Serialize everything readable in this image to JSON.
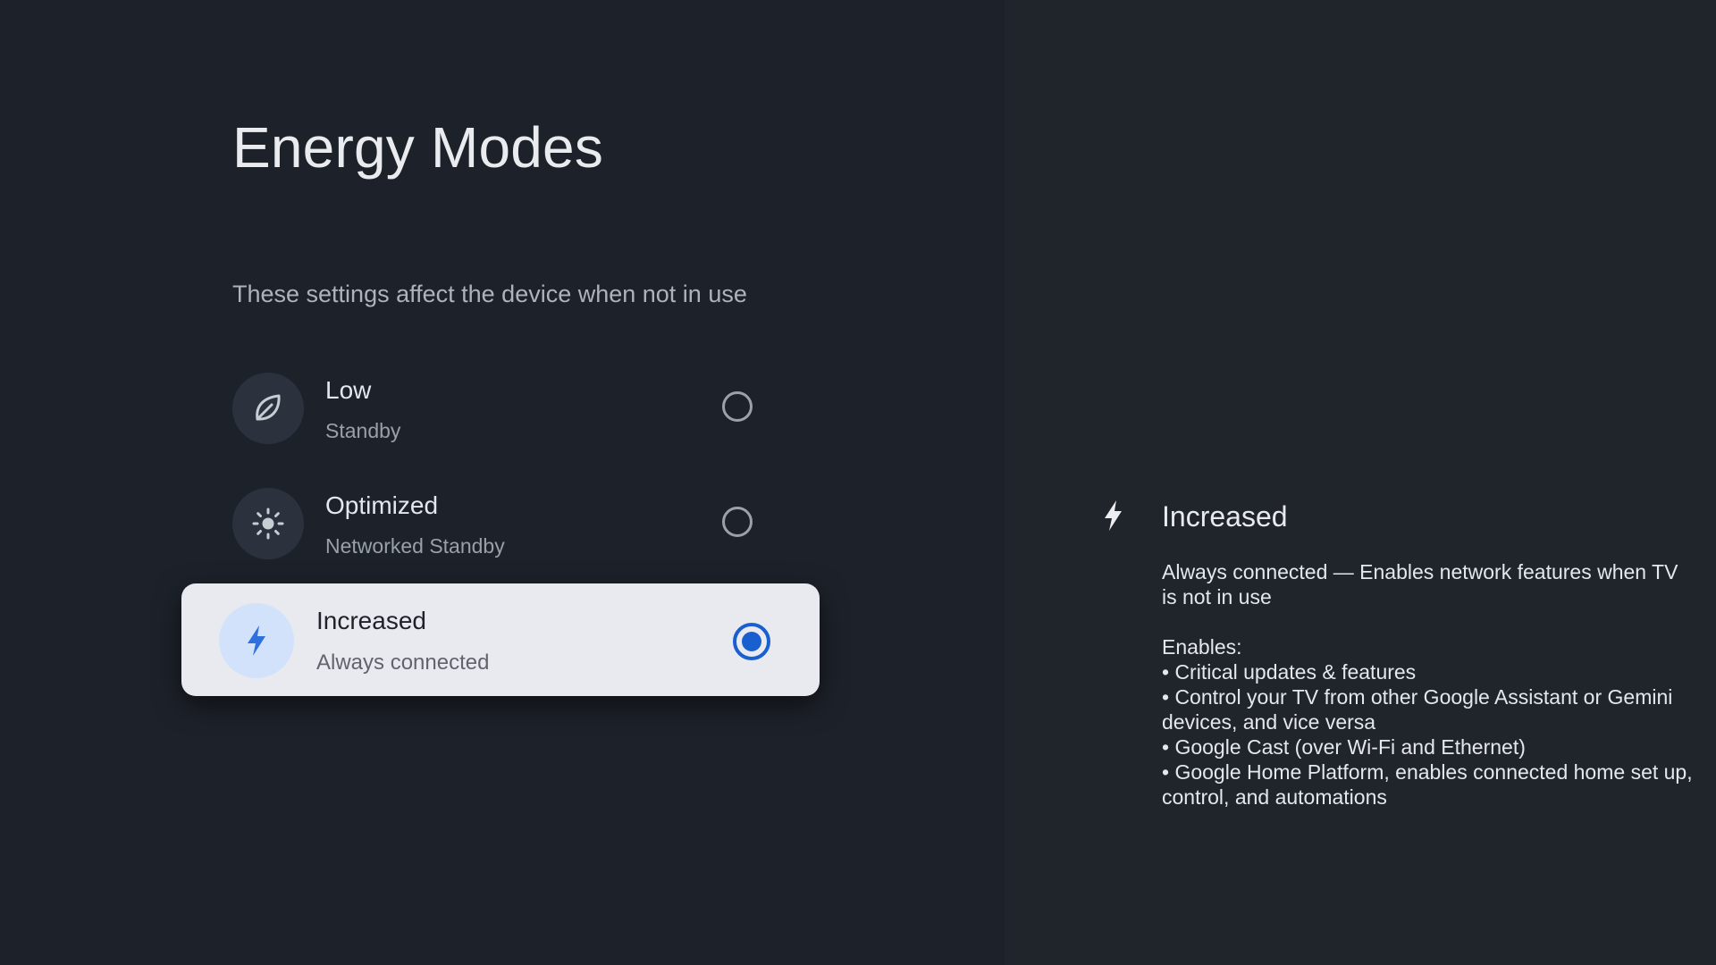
{
  "page": {
    "title": "Energy Modes",
    "subtitle": "These settings affect the device when not in use"
  },
  "options": [
    {
      "label": "Low",
      "sublabel": "Standby",
      "icon": "leaf-icon",
      "selected": false
    },
    {
      "label": "Optimized",
      "sublabel": "Networked Standby",
      "icon": "sun-icon",
      "selected": false
    },
    {
      "label": "Increased",
      "sublabel": "Always connected",
      "icon": "bolt-icon",
      "selected": true
    }
  ],
  "detail": {
    "icon": "bolt-icon",
    "title": "Increased",
    "description": "Always connected — Enables network features when TV is not in use",
    "enables_heading": "Enables:",
    "bullets": [
      "• Critical updates & features",
      "• Control your TV from other Google Assistant or Gemini devices, and vice versa",
      "• Google Cast (over Wi-Fi and Ethernet)",
      "• Google Home Platform, enables connected home set up, control, and automations"
    ]
  },
  "colors": {
    "background": "#1d222a",
    "selected_card": "#e8eaf0",
    "accent_blue": "#1a5fd0",
    "selected_icon_bg": "#d3e2fb"
  }
}
